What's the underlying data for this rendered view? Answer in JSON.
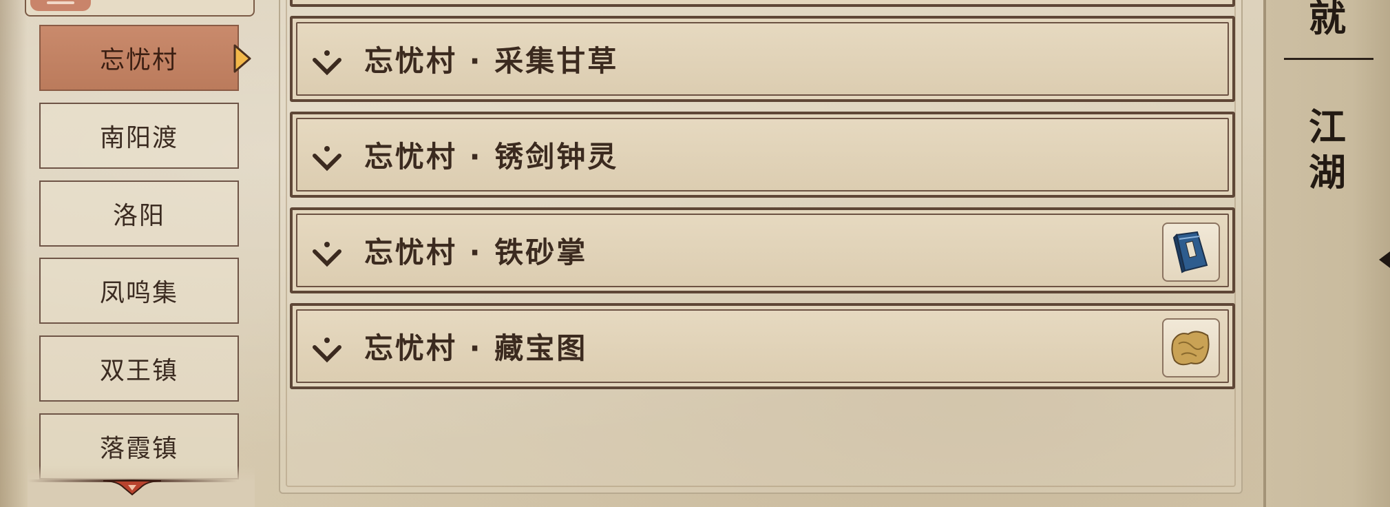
{
  "sidebar": {
    "items": [
      {
        "label": "忘忧村",
        "active": true
      },
      {
        "label": "南阳渡",
        "active": false
      },
      {
        "label": "洛阳",
        "active": false
      },
      {
        "label": "凤鸣集",
        "active": false
      },
      {
        "label": "双王镇",
        "active": false
      },
      {
        "label": "落霞镇",
        "active": false
      }
    ]
  },
  "quests": [
    {
      "title": "忘忧村 · 采集甘草",
      "reward_icon": null
    },
    {
      "title": "忘忧村 · 锈剑钟灵",
      "reward_icon": null
    },
    {
      "title": "忘忧村 · 铁砂掌",
      "reward_icon": "blue-book-icon"
    },
    {
      "title": "忘忧村 · 藏宝图",
      "reward_icon": "treasure-map-icon"
    }
  ],
  "right_spine": {
    "top_char": "就",
    "chars": [
      "江",
      "湖"
    ]
  },
  "colors": {
    "active_tab": "#c98a6c",
    "border_dark": "#5e4636",
    "text_dark": "#3b2a1f",
    "paper": "#d9ccb4"
  }
}
